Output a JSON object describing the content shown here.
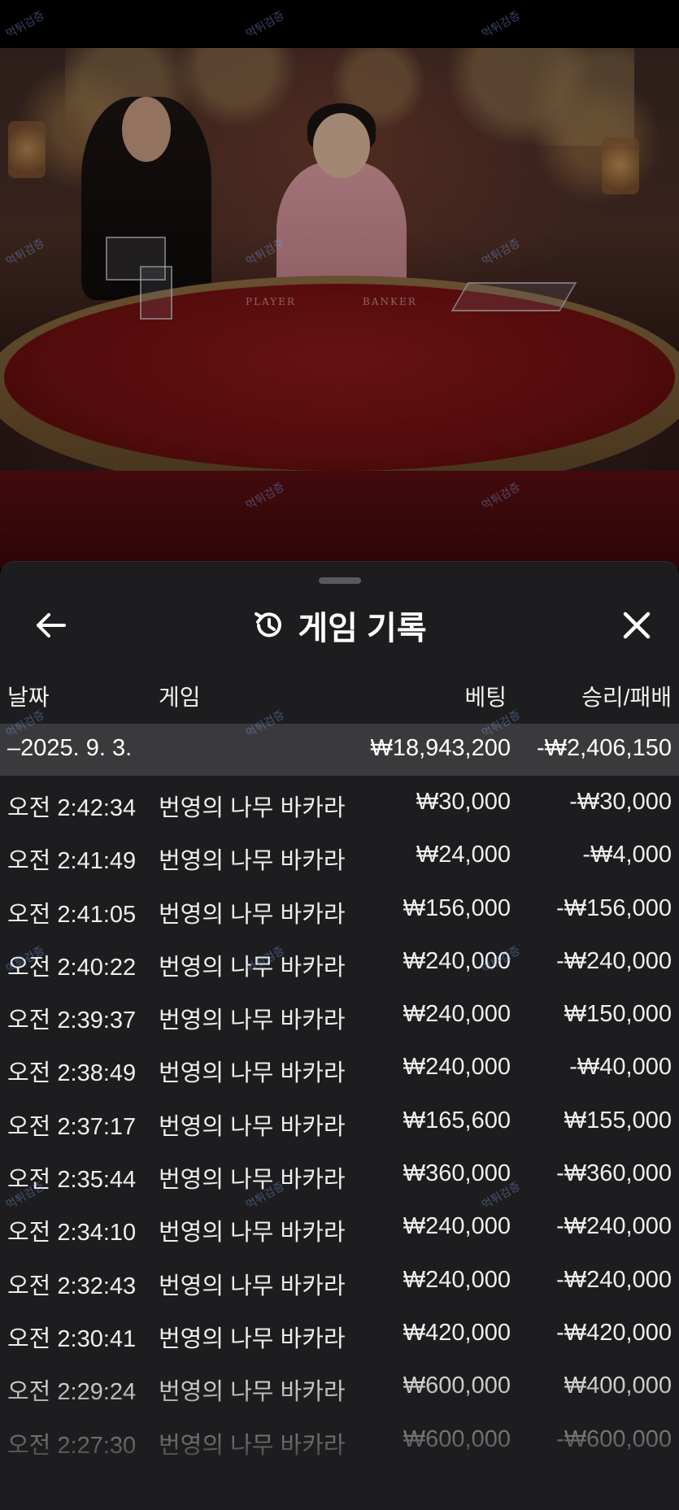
{
  "video": {
    "felt_labels": {
      "player": "PLAYER",
      "banker": "BANKER"
    }
  },
  "panel": {
    "title": "게임 기록",
    "icons": {
      "back": "arrow-left-icon",
      "history": "history-icon",
      "close": "close-icon"
    },
    "columns": {
      "date": "날짜",
      "game": "게임",
      "bet": "베팅",
      "win_loss": "승리/패배"
    },
    "date_group": {
      "date": "–2025. 9. 3.",
      "bet_total": "₩18,943,200",
      "win_loss_total": "-₩2,406,150"
    },
    "rows": [
      {
        "time": "오전 2:42:34",
        "game": "번영의 나무 바카라",
        "bet": "₩30,000",
        "win_loss": "-₩30,000"
      },
      {
        "time": "오전 2:41:49",
        "game": "번영의 나무 바카라",
        "bet": "₩24,000",
        "win_loss": "-₩4,000"
      },
      {
        "time": "오전 2:41:05",
        "game": "번영의 나무 바카라",
        "bet": "₩156,000",
        "win_loss": "-₩156,000"
      },
      {
        "time": "오전 2:40:22",
        "game": "번영의 나무 바카라",
        "bet": "₩240,000",
        "win_loss": "-₩240,000"
      },
      {
        "time": "오전 2:39:37",
        "game": "번영의 나무 바카라",
        "bet": "₩240,000",
        "win_loss": "₩150,000"
      },
      {
        "time": "오전 2:38:49",
        "game": "번영의 나무 바카라",
        "bet": "₩240,000",
        "win_loss": "-₩40,000"
      },
      {
        "time": "오전 2:37:17",
        "game": "번영의 나무 바카라",
        "bet": "₩165,600",
        "win_loss": "₩155,000"
      },
      {
        "time": "오전 2:35:44",
        "game": "번영의 나무 바카라",
        "bet": "₩360,000",
        "win_loss": "-₩360,000"
      },
      {
        "time": "오전 2:34:10",
        "game": "번영의 나무 바카라",
        "bet": "₩240,000",
        "win_loss": "-₩240,000"
      },
      {
        "time": "오전 2:32:43",
        "game": "번영의 나무 바카라",
        "bet": "₩240,000",
        "win_loss": "-₩240,000"
      },
      {
        "time": "오전 2:30:41",
        "game": "번영의 나무 바카라",
        "bet": "₩420,000",
        "win_loss": "-₩420,000"
      },
      {
        "time": "오전 2:29:24",
        "game": "번영의 나무 바카라",
        "bet": "₩600,000",
        "win_loss": "₩400,000"
      },
      {
        "time": "오전 2:27:30",
        "game": "번영의 나무 바카라",
        "bet": "₩600,000",
        "win_loss": "-₩600,000"
      }
    ]
  },
  "watermark": {
    "text": "먹튀검증"
  }
}
